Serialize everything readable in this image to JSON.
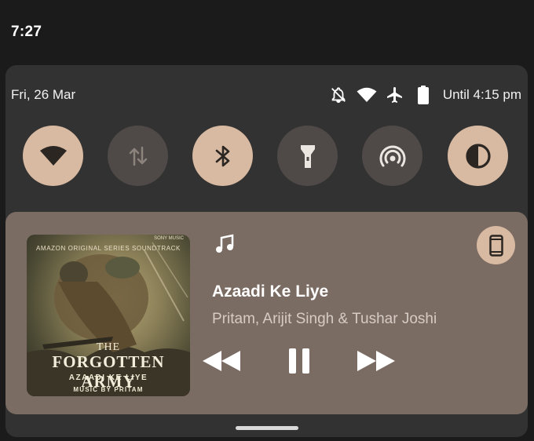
{
  "status_bar": {
    "time": "7:27"
  },
  "header": {
    "date": "Fri, 26 Mar",
    "battery_text": "Until 4:15 pm"
  },
  "header_icons": [
    "notifications-off-icon",
    "wifi-icon",
    "airplane-icon",
    "battery-icon"
  ],
  "quick_tiles": [
    {
      "name": "wifi",
      "icon": "wifi-icon",
      "active": true
    },
    {
      "name": "mobile-data",
      "icon": "data-arrows-icon",
      "active": false
    },
    {
      "name": "bluetooth",
      "icon": "bluetooth-icon",
      "active": true
    },
    {
      "name": "flashlight",
      "icon": "flashlight-icon",
      "active": false
    },
    {
      "name": "hotspot",
      "icon": "hotspot-icon",
      "active": false
    },
    {
      "name": "dark-theme",
      "icon": "dark-theme-icon",
      "active": true
    }
  ],
  "media": {
    "album_art": {
      "top_text": "AMAZON ORIGINAL SERIES SOUNDTRACK",
      "brand": "SONY MUSIC",
      "line1": "THE",
      "line2": "FORGOTTEN ARMY",
      "line3": "AZAADI KE LIYE",
      "line4": "MUSIC BY PRITAM"
    },
    "title": "Azaadi Ke Liye",
    "artist": "Pritam, Arijit Singh & Tushar Joshi",
    "controls": [
      "rewind-icon",
      "pause-icon",
      "fast-forward-icon"
    ]
  },
  "colors": {
    "accent": "#d8b9a1",
    "tile_off": "#4f4a47",
    "panel": "#323232",
    "media_bg": "#7b6c63",
    "background": "#1b1b1b"
  }
}
